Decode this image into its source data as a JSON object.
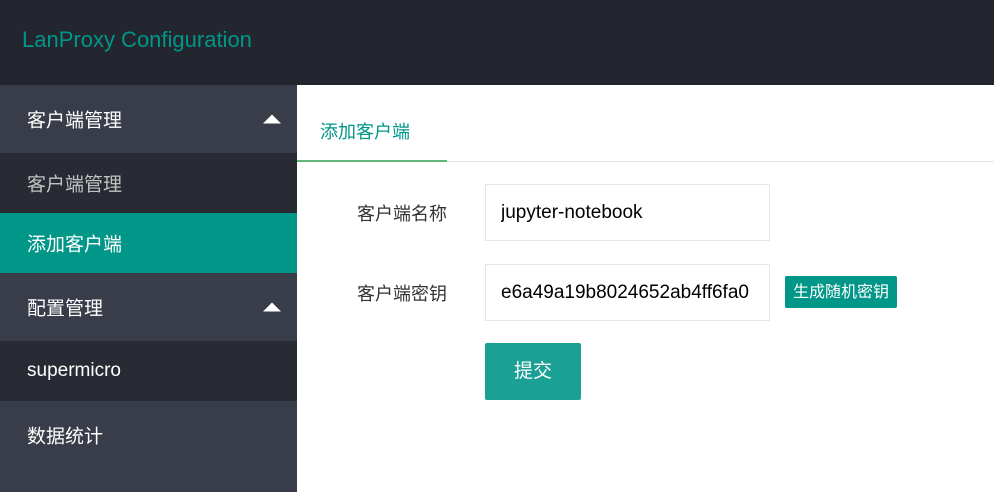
{
  "header": {
    "title": "LanProxy Configuration"
  },
  "sidebar": {
    "group_clients": {
      "label": "客户端管理"
    },
    "item_client_manage": {
      "label": "客户端管理"
    },
    "item_add_client": {
      "label": "添加客户端"
    },
    "group_config": {
      "label": "配置管理"
    },
    "item_supermicro": {
      "label": "supermicro"
    },
    "group_stats": {
      "label": "数据统计"
    }
  },
  "main": {
    "tab": {
      "label": "添加客户端"
    },
    "form": {
      "name_label": "客户端名称",
      "name_value": "jupyter-notebook",
      "key_label": "客户端密钥",
      "key_value": "e6a49a19b8024652ab4ff6fa0",
      "generate_label": "生成随机密钥",
      "submit_label": "提交"
    }
  },
  "colors": {
    "accent": "#009688",
    "header_bg": "#23262e",
    "sidebar_bg": "#393d49",
    "sidebar_child_bg": "#282b33",
    "tab_underline": "#5fb878"
  }
}
